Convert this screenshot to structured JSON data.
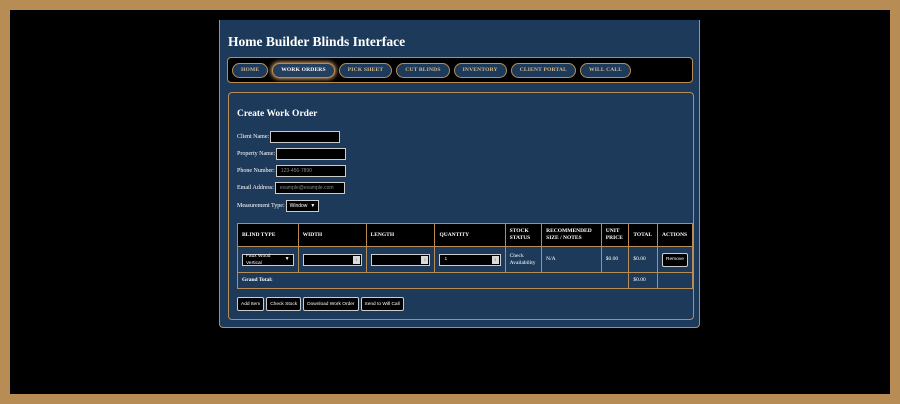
{
  "app": {
    "title": "Home Builder Blinds Interface"
  },
  "nav": {
    "items": [
      {
        "label": "HOME"
      },
      {
        "label": "WORK ORDERS",
        "active": true
      },
      {
        "label": "PICK SHEET"
      },
      {
        "label": "CUT BLINDS"
      },
      {
        "label": "INVENTORY"
      },
      {
        "label": "CLIENT PORTAL"
      },
      {
        "label": "WILL CALL"
      }
    ]
  },
  "form": {
    "title": "Create Work Order",
    "client_name": {
      "label": "Client Name:",
      "value": "",
      "placeholder": ""
    },
    "property_name": {
      "label": "Property Name:",
      "value": "",
      "placeholder": ""
    },
    "phone": {
      "label": "Phone Number:",
      "value": "",
      "placeholder": "123-456-7890"
    },
    "email": {
      "label": "Email Address:",
      "value": "",
      "placeholder": "example@example.com"
    },
    "measurement": {
      "label": "Measurement Type:",
      "value": "Window"
    }
  },
  "table": {
    "headers": [
      "BLIND TYPE",
      "WIDTH",
      "LENGTH",
      "QUANTITY",
      "STOCK STATUS",
      "RECOMMENDED SIZE / NOTES",
      "UNIT PRICE",
      "TOTAL",
      "ACTIONS"
    ],
    "row": {
      "blind_type": "Faux Wood Vertical",
      "width": "",
      "length": "",
      "quantity": "1",
      "stock_status": "Check Availability",
      "notes": "N/A",
      "unit_price": "$0.00",
      "total": "$0.00",
      "action": "Remove"
    },
    "grand_total_label": "Grand Total:",
    "grand_total_value": "$0.00"
  },
  "actions": {
    "add_item": "Add Item",
    "check_stock": "Check Stock",
    "download": "Download Work Order",
    "send": "Send to Will Call"
  },
  "colors": {
    "accent": "#b88d55",
    "panel": "#1d3a5a",
    "background": "#000000"
  }
}
